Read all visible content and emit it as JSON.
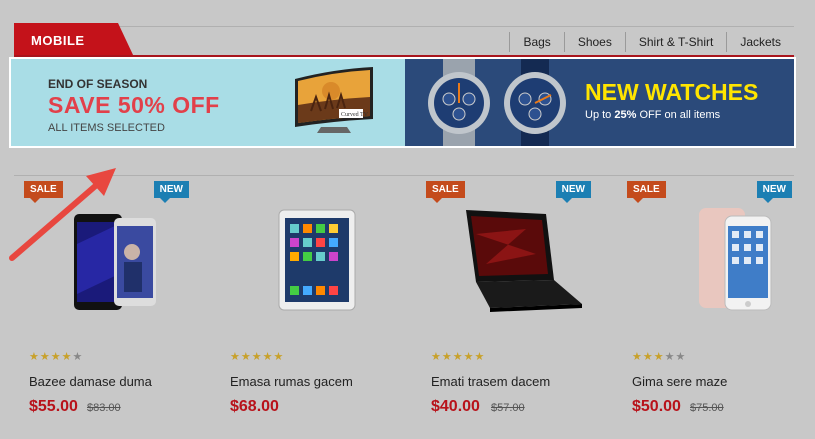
{
  "header": {
    "active_tab": "MOBILE",
    "nav": [
      "Bags",
      "Shoes",
      "Shirt & T-Shirt",
      "Jackets"
    ]
  },
  "banner": {
    "left": {
      "kicker": "END OF SEASON",
      "headline": "SAVE 50% OFF",
      "sub": "ALL ITEMS SELECTED",
      "tv_label": "Curved TV"
    },
    "right": {
      "headline": "NEW WATCHES",
      "sub_prefix": "Up to ",
      "sub_bold": "25%",
      "sub_suffix": " OFF on all items"
    }
  },
  "products": [
    {
      "sale": "SALE",
      "new": "NEW",
      "rating": 4,
      "name": "Bazee damase duma",
      "price": "$55.00",
      "old_price": "$83.00",
      "image": "phone-pair"
    },
    {
      "sale": "",
      "new": "",
      "rating": 5,
      "name": "Emasa rumas gacem",
      "price": "$68.00",
      "old_price": "",
      "image": "tablet"
    },
    {
      "sale": "SALE",
      "new": "NEW",
      "rating": 5,
      "name": "Emati trasem dacem",
      "price": "$40.00",
      "old_price": "$57.00",
      "image": "laptop"
    },
    {
      "sale": "SALE",
      "new": "NEW",
      "rating": 3,
      "name": "Gima sere maze",
      "price": "$50.00",
      "old_price": "$75.00",
      "image": "iphone"
    }
  ],
  "annotation": {
    "icon": "arrow-icon",
    "color": "#e8473f"
  },
  "colors": {
    "brand_red": "#c4121a",
    "sale_badge": "#c44b1c",
    "new_badge": "#1c7fb3",
    "price_red": "#b8121a",
    "banner_blue": "#2b4a7a",
    "banner_cyan": "#a9dde6"
  }
}
